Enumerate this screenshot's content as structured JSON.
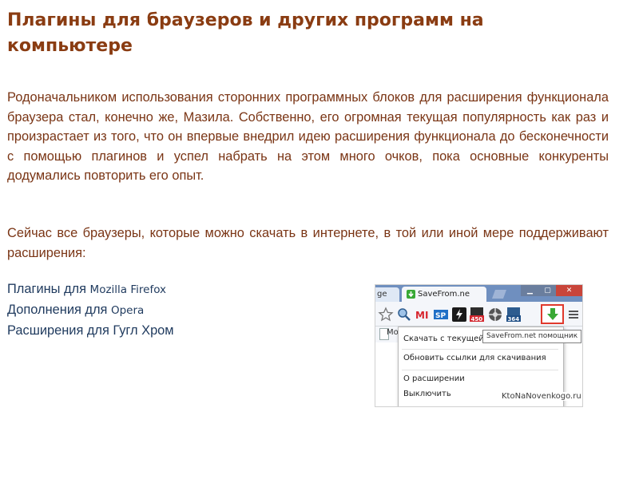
{
  "title": "Плагины для браузеров и других программ на компьютере",
  "paragraphs": [
    "Родоначальником использования сторонних программных блоков для расширения функционала браузера стал, конечно же, Мазила. Собственно, его огромная текущая популярность как раз и произрастает из того, что он впервые внедрил идею расширения функционала до бесконечности с помощью плагинов и успел набрать на этом много очков, пока основные конкуренты додумались повторить его опыт.",
    "Сейчас все браузеры, которые можно скачать в интернете, в той или иной мере поддерживают расширения:"
  ],
  "links": [
    {
      "prefix": "Плагины для ",
      "name": "Mozilla Firefox"
    },
    {
      "prefix": "Дополнения для ",
      "name": "Opera"
    },
    {
      "prefix": "Расширения для Гугл Хром",
      "name": ""
    }
  ],
  "screenshot": {
    "tab_partial": "ge",
    "tab_active": "SaveFrom.ne",
    "bookmark": "Mo",
    "tooltip": "SaveFrom.net помощник",
    "menu": [
      "Скачать с текущей с",
      "Обновить ссылки для скачивания",
      "О расширении",
      "Выключить"
    ],
    "toolbar_badges": {
      "extension_a": "450",
      "extension_b": "364"
    },
    "watermark": "KtoNaNovenkogo.ru",
    "icons": [
      "star-icon",
      "lens-icon",
      "mail-icon",
      "sp-icon",
      "flash-icon",
      "wheel-icon",
      "image-icon",
      "download-arrow-icon",
      "menu-icon"
    ],
    "colors": {
      "tab_strip": "#6f8fbf",
      "highlight_border": "#e0392c",
      "download_arrow": "#39a935"
    }
  }
}
